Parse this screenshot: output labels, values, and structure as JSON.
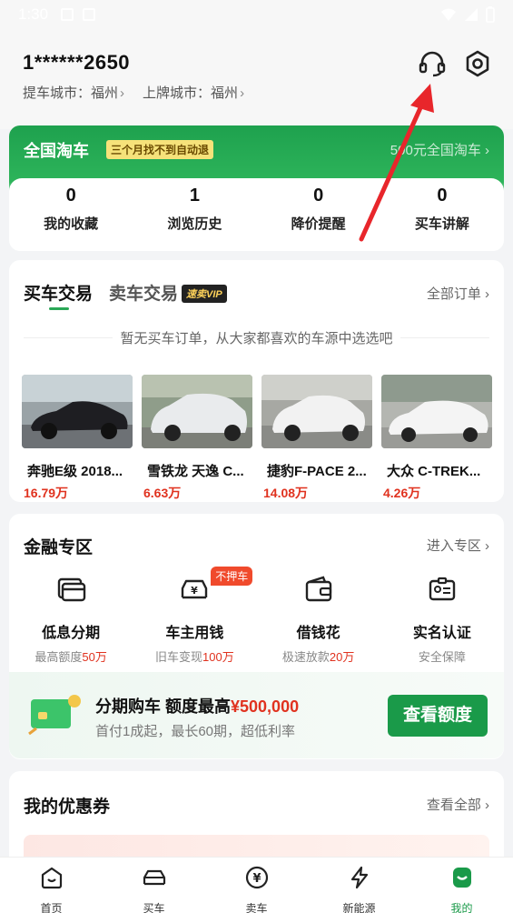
{
  "status_bar": {
    "time": "1:30"
  },
  "header": {
    "phone": "1******2650",
    "pickup_city_label": "提车城市：",
    "pickup_city": "福州",
    "plate_city_label": "上牌城市：",
    "plate_city": "福州",
    "icons": [
      "headset-icon",
      "settings-icon"
    ]
  },
  "promo": {
    "title": "全国淘车",
    "badge": "三个月找不到自动退",
    "right_text": "500元全国淘车",
    "stats": [
      {
        "num": "0",
        "label": "我的收藏"
      },
      {
        "num": "1",
        "label": "浏览历史"
      },
      {
        "num": "0",
        "label": "降价提醒"
      },
      {
        "num": "0",
        "label": "买车讲解"
      }
    ]
  },
  "orders": {
    "tab_buy": "买车交易",
    "tab_sell": "卖车交易",
    "vip_badge": "速卖VIP",
    "all_orders": "全部订单",
    "empty_note": "暂无买车订单，从大家都喜欢的车源中选选吧",
    "cars": [
      {
        "name": "奔驰E级 2018...",
        "price": "16.79万",
        "color": "#1e1e22"
      },
      {
        "name": "雪铁龙 天逸 C...",
        "price": "6.63万",
        "color": "#e9ebed"
      },
      {
        "name": "捷豹F-PACE 2...",
        "price": "14.08万",
        "color": "#f2f2f2"
      },
      {
        "name": "大众 C-TREK...",
        "price": "4.26万",
        "color": "#f4f4f4"
      }
    ]
  },
  "finance": {
    "title": "金融专区",
    "enter": "进入专区",
    "items": [
      {
        "title": "低息分期",
        "sub": "最高额度",
        "hl": "50万",
        "icon": "card-icon"
      },
      {
        "title": "车主用钱",
        "sub": "旧车变现",
        "hl": "100万",
        "icon": "car-yuan-icon",
        "tag": "不押车"
      },
      {
        "title": "借钱花",
        "sub": "极速放款",
        "hl": "20万",
        "icon": "wallet-icon"
      },
      {
        "title": "实名认证",
        "sub": "安全保障",
        "hl": "",
        "icon": "id-card-icon"
      }
    ],
    "banner": {
      "title_a": "分期购车",
      "title_b": "额度最高",
      "amount": "¥500,000",
      "sub": "首付1成起，最长60期，超低利率",
      "button": "查看额度"
    }
  },
  "coupons": {
    "title": "我的优惠券",
    "see_all": "查看全部"
  },
  "tabbar": [
    {
      "label": "首页",
      "icon": "home-icon"
    },
    {
      "label": "买车",
      "icon": "car-icon"
    },
    {
      "label": "卖车",
      "icon": "yuan-icon"
    },
    {
      "label": "新能源",
      "icon": "lightning-icon"
    },
    {
      "label": "我的",
      "icon": "profile-icon",
      "active": true
    }
  ],
  "colors": {
    "brand_green": "#1a9a49",
    "price_red": "#e0321f",
    "annotation_arrow": "#e8262b"
  }
}
